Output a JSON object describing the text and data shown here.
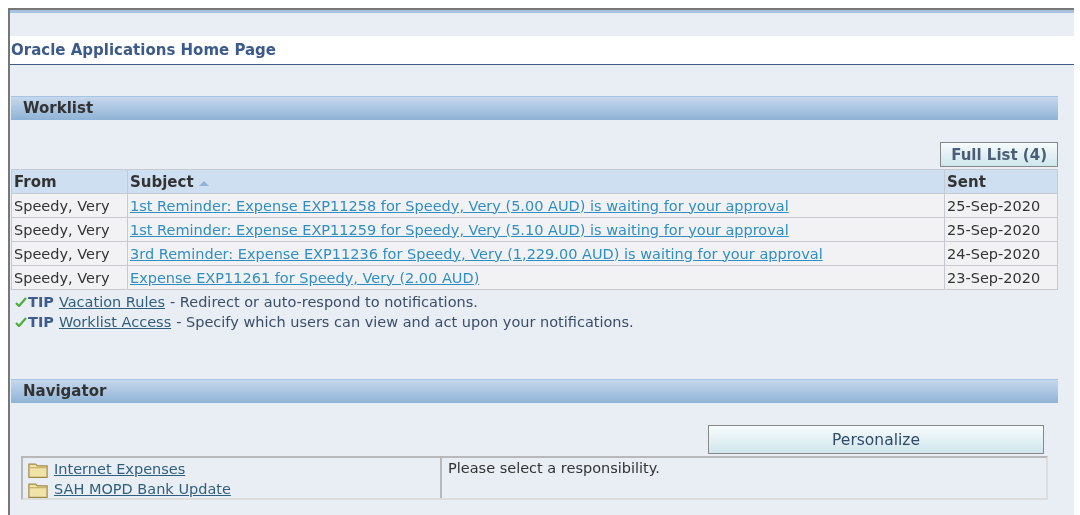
{
  "page": {
    "title": "Oracle Applications Home Page"
  },
  "worklist": {
    "title": "Worklist",
    "full_list_button": "Full List (4)",
    "columns": [
      {
        "label": "From",
        "sorted": false
      },
      {
        "label": "Subject",
        "sorted": true
      },
      {
        "label": "Sent",
        "sorted": false
      }
    ],
    "rows": [
      {
        "from": "Speedy, Very",
        "subject": "1st Reminder: Expense EXP11258 for Speedy, Very (5.00 AUD) is waiting for your approval",
        "sent": "25-Sep-2020"
      },
      {
        "from": "Speedy, Very",
        "subject": "1st Reminder: Expense EXP11259 for Speedy, Very (5.10 AUD) is waiting for your approval",
        "sent": "25-Sep-2020"
      },
      {
        "from": "Speedy, Very",
        "subject": "3rd Reminder: Expense EXP11236 for Speedy, Very (1,229.00 AUD) is waiting for your approval",
        "sent": "24-Sep-2020"
      },
      {
        "from": "Speedy, Very",
        "subject": "Expense EXP11261 for Speedy, Very (2.00 AUD)",
        "sent": "23-Sep-2020"
      }
    ],
    "tips": [
      {
        "label": "TIP",
        "link": "Vacation Rules",
        "text": "- Redirect or auto-respond to notifications."
      },
      {
        "label": "TIP",
        "link": "Worklist Access",
        "text": "- Specify which users can view and act upon your notifications."
      }
    ]
  },
  "navigator": {
    "title": "Navigator",
    "personalize_button": "Personalize",
    "responsibilities": [
      "Internet Expenses",
      "SAH MOPD Bank Update"
    ],
    "message": "Please select a responsibility."
  }
}
